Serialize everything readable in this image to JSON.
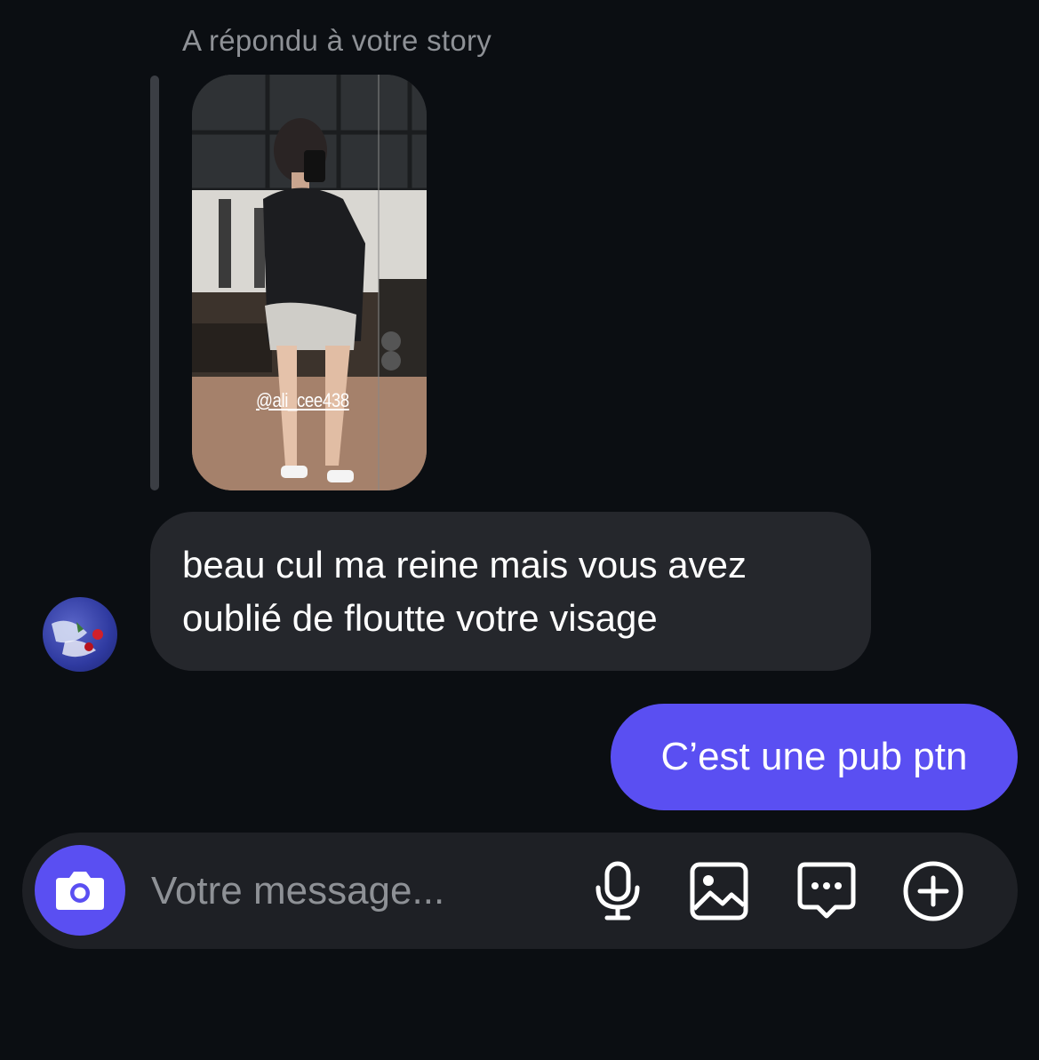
{
  "story_reply": {
    "caption": "A répondu à votre story",
    "mention_tag": "@ali_cee438"
  },
  "messages": [
    {
      "direction": "incoming",
      "lines": [
        "beau cul ma reine mais vous avez",
        "oublié de floutte votre visage"
      ]
    },
    {
      "direction": "outgoing",
      "text": "C’est une pub ptn"
    }
  ],
  "composer": {
    "placeholder": "Votre message...",
    "icons": [
      "camera-icon",
      "microphone-icon",
      "image-icon",
      "sticker-icon",
      "plus-icon"
    ]
  },
  "colors": {
    "background": "#0b0e12",
    "incoming_bubble": "#25272c",
    "outgoing_bubble": "#5a4ff2",
    "composer_bg": "#1e2025",
    "muted_text": "#8e9196"
  }
}
